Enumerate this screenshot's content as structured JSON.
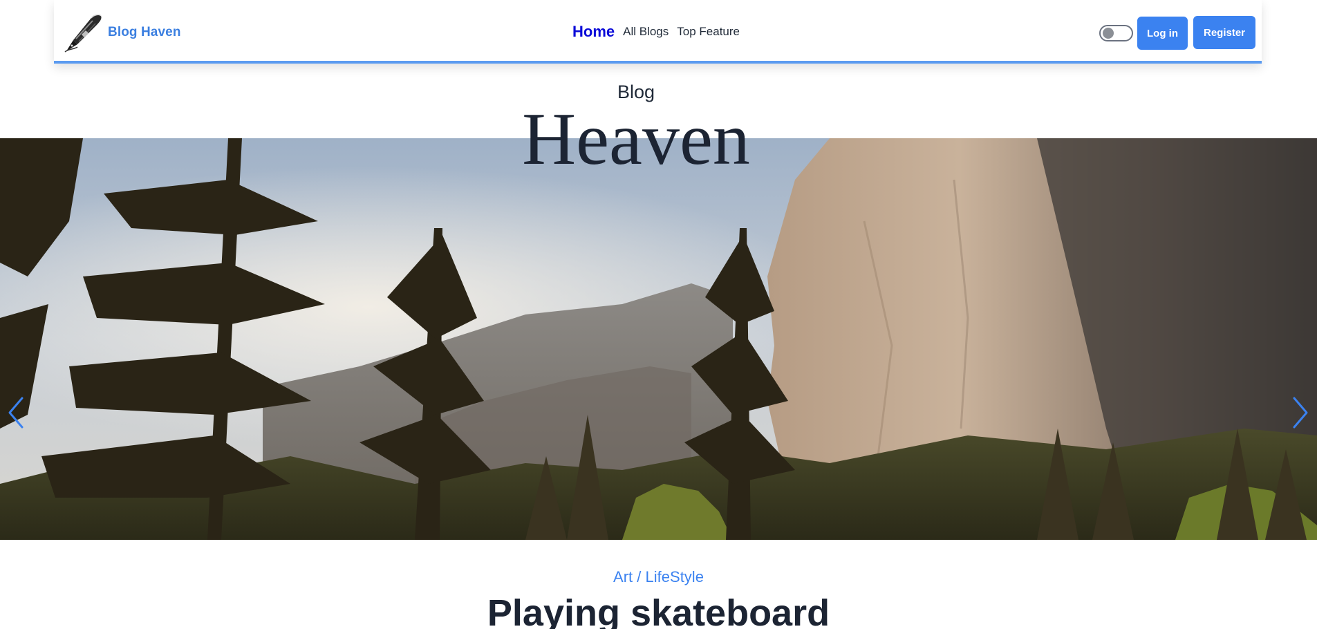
{
  "navbar": {
    "brand_name": "Blog Haven",
    "links": [
      {
        "label": "Home",
        "active": true
      },
      {
        "label": "All Blogs",
        "active": false
      },
      {
        "label": "Top Feature",
        "active": false
      }
    ],
    "theme_toggle_on": false,
    "login_label": "Log in",
    "register_label": "Register"
  },
  "hero": {
    "small_title": "Blog",
    "big_title": "Heaven"
  },
  "featured_post": {
    "category_primary": "Art",
    "category_separator": "/",
    "category_secondary": "LifeStyle",
    "title": "Playing skateboard"
  },
  "colors": {
    "accent_blue": "#3b82f0",
    "active_link": "#0a0ad8",
    "navbar_border": "#5b9bf0",
    "heading_dark": "#1c2433"
  },
  "icons": {
    "logo": "fountain-pen-icon",
    "prev": "chevron-left-icon",
    "next": "chevron-right-icon"
  }
}
